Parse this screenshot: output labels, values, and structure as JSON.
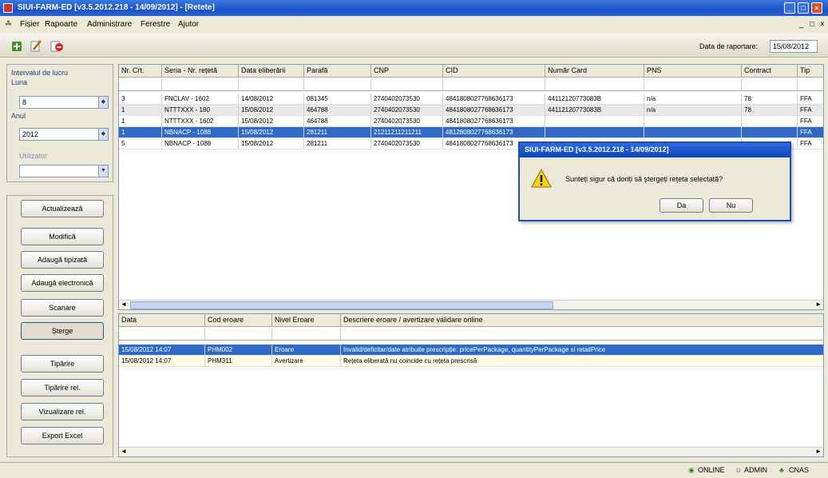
{
  "window": {
    "title": "SIUI-FARM-ED [v3.5.2012.218 - 14/09/2012] - [Retete]",
    "minimize": "_",
    "maximize": "□",
    "close": "×"
  },
  "menu": {
    "items": [
      "Fișier",
      "Rapoarte",
      "Administrare",
      "Ferestre",
      "Ajutor"
    ],
    "right_controls": [
      "_",
      "□",
      "×"
    ]
  },
  "toolbar": {
    "icons": [
      "add-icon",
      "edit-icon",
      "delete-icon"
    ],
    "date_label": "Data de raportare:",
    "date_value": "15/08/2012"
  },
  "left_panel": {
    "group_label": "Intervalul de lucru",
    "luna_label": "Luna",
    "luna_value": "8",
    "anul_label": "Anul",
    "anul_value": "2012",
    "utilizator_label": "Utilizator",
    "utilizator_value": "",
    "buttons": [
      "Actualizează",
      "Modifică",
      "Adaugă tipizată",
      "Adaugă electronică",
      "Scanare",
      "Șterge",
      "Tipărire",
      "Tipărire rel.",
      "Vizualizare rel.",
      "Export Excel"
    ],
    "icons": [
      "calendar-spin-icon",
      "dropdown-arrow-icon"
    ]
  },
  "top_grid": {
    "columns": [
      "Nr. Crt.",
      "Seria - Nr. rețetă",
      "Data eliberării",
      "Parafă",
      "CNP",
      "CID",
      "Număr Card",
      "PNS",
      "Contract",
      "Tip"
    ],
    "rows": [
      [
        "3",
        "FNCLAV - 1602",
        "14/08/2012",
        "081345",
        "2740402073530",
        "4841808027768636173",
        "44112120773083B",
        "n/a",
        "78",
        "FFA"
      ],
      [
        "1",
        "NTTTXXX - 180",
        "15/08/2012",
        "464788",
        "2740402073530",
        "4841808027768636173",
        "44112120773083B",
        "n/a",
        "78",
        "FFA"
      ],
      [
        "1",
        "NTTTXXX - 1602",
        "15/08/2012",
        "464788",
        "2740402073530",
        "4841808027768636173",
        "",
        "",
        "",
        "FFA"
      ],
      [
        "1",
        "NBNACP - 1088",
        "15/08/2012",
        "281211",
        "21211211211211",
        "4812808027768636173",
        "",
        "",
        "",
        "FFA"
      ],
      [
        "5",
        "NBNACP - 1088",
        "15/08/2012",
        "281211",
        "2740402073530",
        "4841808027768636173",
        "",
        "",
        "",
        "FFA"
      ]
    ]
  },
  "bottom_grid": {
    "columns": [
      "Data",
      "Cod eroare",
      "Nivel Eroare",
      "Descriere eroare / avertizare validare online"
    ],
    "rows": [
      [
        "15/08/2012 14:07",
        "PHM002",
        "Eroare",
        "Invalid/deficitar/date atribuite prescripție: pricePerPackage, quantityPerPackage si retailPrice"
      ],
      [
        "15/08/2012 14:07",
        "PHM311",
        "Avertizare",
        "Rețeta eliberată nu coincide cu rețeta prescrisă"
      ]
    ]
  },
  "dialog": {
    "title": "SIUI-FARM-ED [v3.5.2012.218 - 14/09/2012]",
    "message": "Sunteți sigur că doriți să ștergeți rețeta selectată?",
    "yes": "Da",
    "no": "Nu",
    "icon": "warning-icon"
  },
  "status": {
    "online": "ONLINE",
    "user": "ADMIN",
    "cnas": "CNAS"
  },
  "colors": {
    "selection": "#316ac5",
    "titlebar": "#1b52c8",
    "background": "#ece9d8"
  }
}
